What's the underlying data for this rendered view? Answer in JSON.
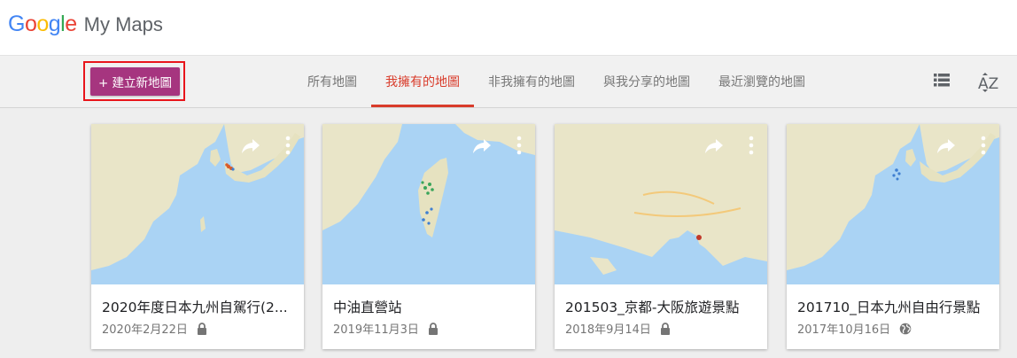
{
  "app": {
    "logo_letters": [
      "G",
      "o",
      "o",
      "g",
      "l",
      "e"
    ],
    "logo_colors": [
      "#4285f4",
      "#ea4335",
      "#fbbc05",
      "#4285f4",
      "#34a853",
      "#ea4335"
    ],
    "product": "My Maps"
  },
  "toolbar": {
    "create_label": "+ 建立新地圖",
    "tabs": [
      {
        "label": "所有地圖"
      },
      {
        "label": "我擁有的地圖"
      },
      {
        "label": "非我擁有的地圖"
      },
      {
        "label": "與我分享的地圖"
      },
      {
        "label": "最近瀏覽的地圖"
      }
    ],
    "active_tab": 1,
    "list_view_icon": "list-view-icon",
    "sort_icon": "sort-az-icon",
    "sort_label": "AZ"
  },
  "maps": [
    {
      "title": "2020年度日本九州自駕行(2...",
      "date": "2020年2月22日",
      "visibility": "lock-icon"
    },
    {
      "title": "中油直營站",
      "date": "2019年11月3日",
      "visibility": "lock-icon"
    },
    {
      "title": "201503_京都-大阪旅遊景點",
      "date": "2018年9月14日",
      "visibility": "lock-icon"
    },
    {
      "title": "201710_日本九州自由行景點",
      "date": "2017年10月16日",
      "visibility": "globe-icon"
    }
  ],
  "colors": {
    "accent": "#a6357f",
    "active_tab": "#d93c2b",
    "highlight_box": "#e8151b",
    "land": "#e9e5c8",
    "water": "#aad3f4"
  }
}
